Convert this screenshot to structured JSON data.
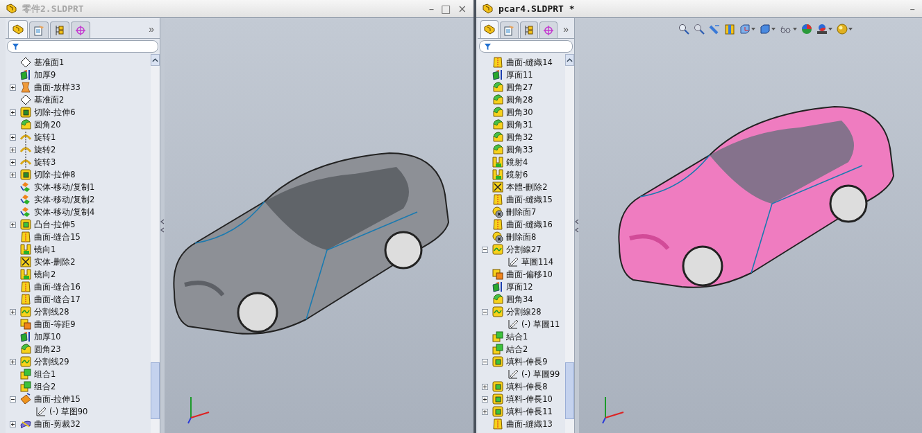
{
  "windows": [
    {
      "title": "零件2.SLDPRT",
      "active": false,
      "controls": [
        "–",
        "□",
        "×"
      ],
      "heads_up_toolbar": false,
      "tabs": [
        {
          "kind": "features",
          "selected": true
        },
        {
          "kind": "properties",
          "selected": false
        },
        {
          "kind": "configurations",
          "selected": false
        },
        {
          "kind": "dimxpert",
          "selected": false
        }
      ],
      "more": "»",
      "tree": [
        {
          "label": "基准面1",
          "kind": "plane"
        },
        {
          "label": "加厚9",
          "kind": "thicken"
        },
        {
          "label": "曲面-放样33",
          "kind": "loft",
          "expanded": false
        },
        {
          "label": "基准面2",
          "kind": "plane"
        },
        {
          "label": "切除-拉伸6",
          "kind": "cut",
          "expanded": false
        },
        {
          "label": "圆角20",
          "kind": "fillet"
        },
        {
          "label": "旋转1",
          "kind": "revolve",
          "expanded": false
        },
        {
          "label": "旋转2",
          "kind": "revolve",
          "expanded": false
        },
        {
          "label": "旋转3",
          "kind": "revolve",
          "expanded": false
        },
        {
          "label": "切除-拉伸8",
          "kind": "cut",
          "expanded": false
        },
        {
          "label": "实体-移动/复制1",
          "kind": "move"
        },
        {
          "label": "实体-移动/复制2",
          "kind": "move"
        },
        {
          "label": "实体-移动/复制4",
          "kind": "move"
        },
        {
          "label": "凸台-拉伸5",
          "kind": "boss",
          "expanded": false
        },
        {
          "label": "曲面-缝合15",
          "kind": "knit"
        },
        {
          "label": "镜向1",
          "kind": "mirror"
        },
        {
          "label": "实体-删除2",
          "kind": "delete-body"
        },
        {
          "label": "镜向2",
          "kind": "mirror"
        },
        {
          "label": "曲面-缝合16",
          "kind": "knit"
        },
        {
          "label": "曲面-缝合17",
          "kind": "knit"
        },
        {
          "label": "分割线28",
          "kind": "split",
          "expanded": false
        },
        {
          "label": "曲面-等距9",
          "kind": "offset"
        },
        {
          "label": "加厚10",
          "kind": "thicken"
        },
        {
          "label": "圆角23",
          "kind": "fillet"
        },
        {
          "label": "分割线29",
          "kind": "split",
          "expanded": false
        },
        {
          "label": "组合1",
          "kind": "combine"
        },
        {
          "label": "组合2",
          "kind": "combine"
        },
        {
          "label": "曲面-拉伸15",
          "kind": "surface-extrude",
          "expanded": true,
          "children": [
            {
              "label": "(-) 草图90",
              "kind": "sketch"
            }
          ]
        },
        {
          "label": "曲面-剪裁32",
          "kind": "trim",
          "expanded": false
        }
      ]
    },
    {
      "title": "pcar4.SLDPRT *",
      "active": true,
      "controls": [
        "–"
      ],
      "heads_up_toolbar": true,
      "tabs": [
        {
          "kind": "features",
          "selected": true
        },
        {
          "kind": "properties",
          "selected": false
        },
        {
          "kind": "configurations",
          "selected": false
        },
        {
          "kind": "dimxpert",
          "selected": false
        }
      ],
      "more": "»",
      "tree": [
        {
          "label": "曲面-縫織14",
          "kind": "knit"
        },
        {
          "label": "厚面11",
          "kind": "thicken"
        },
        {
          "label": "圓角27",
          "kind": "fillet"
        },
        {
          "label": "圓角28",
          "kind": "fillet"
        },
        {
          "label": "圓角30",
          "kind": "fillet"
        },
        {
          "label": "圓角31",
          "kind": "fillet"
        },
        {
          "label": "圓角32",
          "kind": "fillet"
        },
        {
          "label": "圓角33",
          "kind": "fillet"
        },
        {
          "label": "鏡射4",
          "kind": "mirror"
        },
        {
          "label": "鏡射6",
          "kind": "mirror"
        },
        {
          "label": "本體-刪除2",
          "kind": "delete-body"
        },
        {
          "label": "曲面-縫織15",
          "kind": "knit"
        },
        {
          "label": "刪除面7",
          "kind": "delete-face"
        },
        {
          "label": "曲面-縫織16",
          "kind": "knit"
        },
        {
          "label": "刪除面8",
          "kind": "delete-face"
        },
        {
          "label": "分割線27",
          "kind": "split",
          "expanded": true,
          "children": [
            {
              "label": "草圖114",
              "kind": "sketch"
            }
          ]
        },
        {
          "label": "曲面-偏移10",
          "kind": "offset"
        },
        {
          "label": "厚面12",
          "kind": "thicken"
        },
        {
          "label": "圓角34",
          "kind": "fillet"
        },
        {
          "label": "分割線28",
          "kind": "split",
          "expanded": true,
          "children": [
            {
              "label": "(-) 草圖11",
              "kind": "sketch"
            }
          ]
        },
        {
          "label": "結合1",
          "kind": "combine"
        },
        {
          "label": "結合2",
          "kind": "combine"
        },
        {
          "label": "填料-伸長9",
          "kind": "boss",
          "expanded": true,
          "children": [
            {
              "label": "(-) 草圖99",
              "kind": "sketch"
            }
          ]
        },
        {
          "label": "填料-伸長8",
          "kind": "boss",
          "expanded": false
        },
        {
          "label": "填料-伸長10",
          "kind": "boss",
          "expanded": false
        },
        {
          "label": "填料-伸長11",
          "kind": "boss",
          "expanded": false
        },
        {
          "label": "曲面-縫織13",
          "kind": "knit"
        }
      ]
    }
  ]
}
